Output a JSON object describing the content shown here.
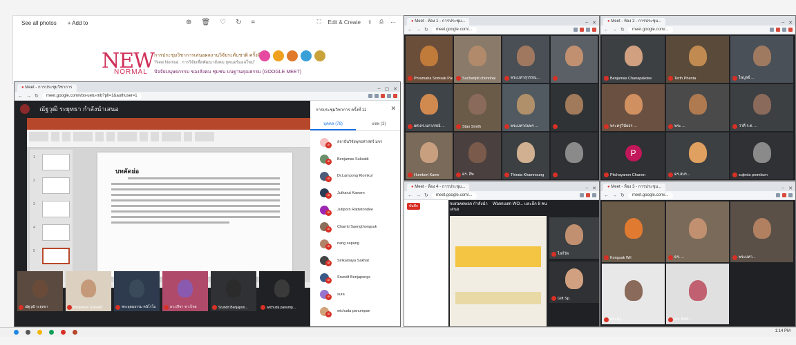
{
  "photo_viewer": {
    "see_all": "See all photos",
    "add_to": "+ Add to",
    "edit_create": "Edit & Create",
    "banner": {
      "new": "NEW",
      "normal": "NORMAL",
      "line1": "การประชุมวิชาการเสนอผลงานวิจัยระดับชาติ ครั้งที่ 11",
      "line2": "\"New Normal : การวิจัยเพื่อพัฒนาสังคม ยุคนอร์มอลใหม่\"",
      "line3": "ปัจจัยมนุษยกรรม ของสังคม ชุมชน บนฐานคุณธรรม (GOOGLE MEET)"
    }
  },
  "meet_main": {
    "tab_title": "Meet - การประชุมวิชาการ",
    "url": "meet.google.com/vbo-uetu-tnb?pli=1&authuser=1",
    "presenting": "ณัฐวุฒิ ระยุทธา กำลังนำเสนอ",
    "slide_heading": "บทคัดย่อ",
    "panel_title": "การประชุมวิชาการ ครั้งที่ 11",
    "tab_people": "บุคคล (78)",
    "tab_chat": "แชท (3)",
    "participants": [
      {
        "name": "สถาบันวิจัยพุทธศาสตร์ มจร",
        "color": "#f5c0c0"
      },
      {
        "name": "Benjamas Suksatit",
        "color": "#6b8e6b"
      },
      {
        "name": "Dr.Lampong Klomkul",
        "color": "#4b5d7a"
      },
      {
        "name": "Jutharut Kaewm",
        "color": "#2b3a55"
      },
      {
        "name": "Jutiporn Rattwtondee",
        "color": "#9c27b0"
      },
      {
        "name": "Charnti Saengthongsuk",
        "color": "#8a6f5b"
      },
      {
        "name": "nang sapang",
        "color": "#b0826a"
      },
      {
        "name": "Sirikamaya Sakhat",
        "color": "#444"
      },
      {
        "name": "Srundit Benjapongs",
        "color": "#3a5a8a"
      },
      {
        "name": "sura",
        "color": "#9575cd"
      },
      {
        "name": "wichuda panumpan",
        "color": "#d1a37a"
      }
    ],
    "strip": [
      {
        "name": "ณัฐวุฒิ ระยุทธา"
      },
      {
        "name": "Benjamas Suksatit"
      },
      {
        "name": "พระอุดมธรรม คนิโรโม"
      },
      {
        "name": "ดร.ปรีชา ชาวไทย"
      },
      {
        "name": "Srundit Benjapon..."
      },
      {
        "name": "wichuda panump..."
      }
    ]
  },
  "meet_tr1": {
    "tab_title": "Meet - ห้อง 1 - การประชุม...",
    "url": "meet.google.com/...",
    "popup": "Phramaha Somsak ...",
    "tiles": [
      {
        "name": "Phramaha Somsak Passs..."
      },
      {
        "name": "Suchartpit chimnhai"
      },
      {
        "name": "พระมหาสุวรรณ..."
      },
      {
        "name": ""
      },
      {
        "name": "ผศ.ดร.นภาภรณ์ ..."
      },
      {
        "name": "Stan Smith"
      },
      {
        "name": "พระมหาธนพร ..."
      },
      {
        "name": ""
      },
      {
        "name": "Humbert Kaew"
      },
      {
        "name": "ดร. สิพ"
      },
      {
        "name": "Thirata Khamnoung"
      },
      {
        "name": ""
      }
    ]
  },
  "meet_tr2": {
    "tab_title": "Meet - ห้อง 2 - การประชุม...",
    "url": "meet.google.com/...",
    "tiles": [
      {
        "name": "Benjamas Chanapakdee"
      },
      {
        "name": "Terth Phenta"
      },
      {
        "name": "ไพบูลย์ ..."
      },
      {
        "name": "พระครูวินัยธร ..."
      },
      {
        "name": "พระ ..."
      },
      {
        "name": "ว่าที่ ร.ต. ..."
      },
      {
        "name": "Pitchayanon Chanon",
        "initial": "P"
      },
      {
        "name": "ดร.สมร..."
      },
      {
        "name": "sujinda promkum"
      }
    ]
  },
  "meet_br1": {
    "tab_title": "Meet - ห้อง 4 - การประชุม...",
    "url": "meet.google.com/...",
    "record": "บันทึก",
    "presenter": "nuirawewan กำลังนำเสนอ",
    "presenter2": "Wannuum WO... และอีก 8 คน",
    "tiles": [
      {
        "name": "ไลก์วัด"
      },
      {
        "name": "Gift Sp."
      }
    ]
  },
  "meet_br2": {
    "tab_title": "Meet - ห้อง 3 - การประชุม...",
    "url": "meet.google.com/...",
    "tiles": [
      {
        "name": "Kongsak Wil"
      },
      {
        "name": "ดร. ..."
      },
      {
        "name": "พระมหา..."
      },
      {
        "name": "พระครู..."
      },
      {
        "name": "ดร. พิมพ์..."
      }
    ]
  },
  "taskbar": {
    "clock": "1:14 PM"
  }
}
